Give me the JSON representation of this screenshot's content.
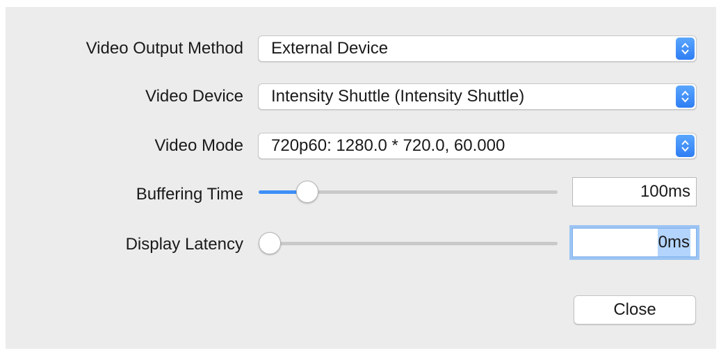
{
  "settings": {
    "output_method": {
      "label": "Video Output Method",
      "value": "External Device"
    },
    "device": {
      "label": "Video Device",
      "value": "Intensity Shuttle (Intensity Shuttle)"
    },
    "mode": {
      "label": "Video Mode",
      "value": "720p60: 1280.0 * 720.0, 60.000"
    },
    "buffering": {
      "label": "Buffering Time",
      "value": "100ms",
      "slider_fraction": 0.13
    },
    "latency": {
      "label": "Display Latency",
      "value": "0ms",
      "slider_fraction": 0.0
    }
  },
  "actions": {
    "close_label": "Close"
  },
  "colors": {
    "accent": "#3d8ef7",
    "panel_bg": "#ececec",
    "focus_ring": "#9cc4f3"
  }
}
